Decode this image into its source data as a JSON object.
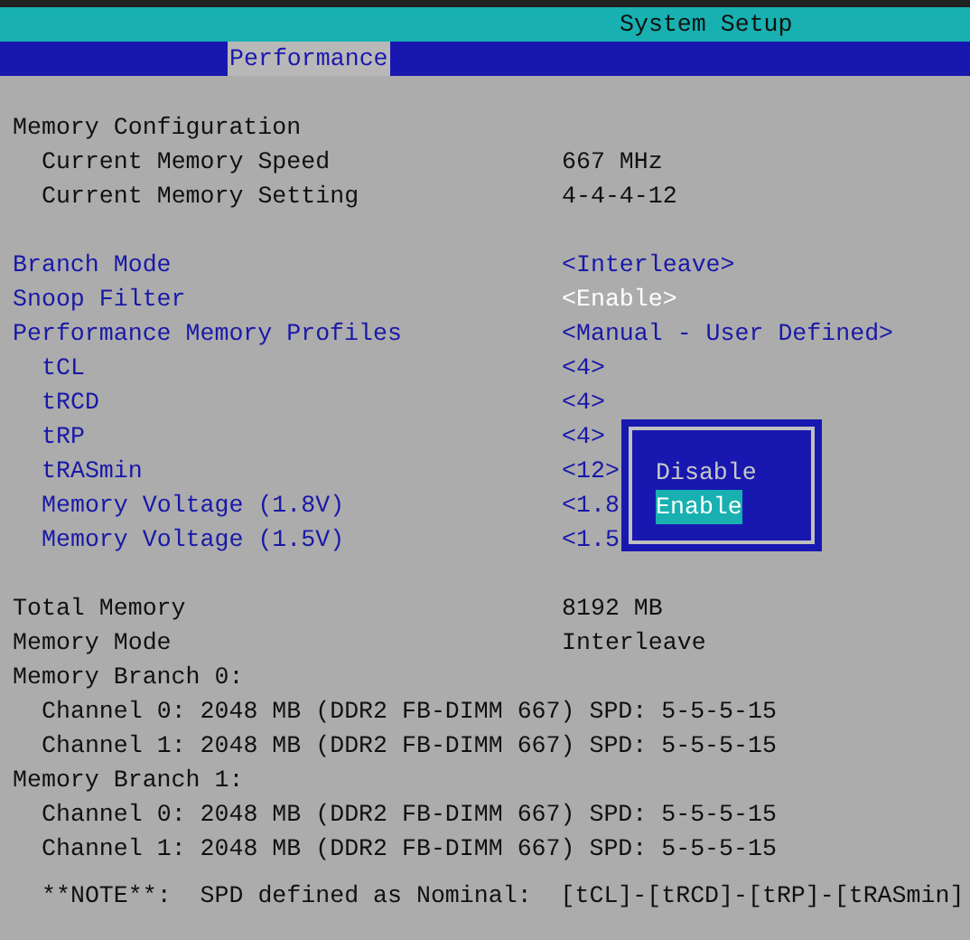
{
  "window": {
    "title": "System Setup"
  },
  "tabs": [
    {
      "label": "Performance",
      "selected": true
    }
  ],
  "sections": [
    {
      "items": [
        {
          "kind": "info",
          "label": "Memory Configuration",
          "children": [
            {
              "kind": "info",
              "label": "Current Memory Speed",
              "value": "667 MHz"
            },
            {
              "kind": "info",
              "label": "Current Memory Setting",
              "value": "4-4-4-12"
            }
          ]
        }
      ]
    },
    {
      "items": [
        {
          "kind": "option",
          "label": "Branch Mode",
          "value": "<Interleave>",
          "selected": false
        },
        {
          "kind": "option",
          "label": "Snoop Filter",
          "value": "<Enable>",
          "selected": true
        },
        {
          "kind": "option",
          "label": "Performance Memory Profiles",
          "value": "<Manual - User Defined>",
          "selected": false,
          "children": [
            {
              "kind": "option",
              "label": "tCL",
              "value": "<4>",
              "selected": false
            },
            {
              "kind": "option",
              "label": "tRCD",
              "value": "<4>",
              "selected": false
            },
            {
              "kind": "option",
              "label": "tRP",
              "value": "<4>",
              "selected": false
            },
            {
              "kind": "option",
              "label": "tRASmin",
              "value": "<12>",
              "selected": false
            },
            {
              "kind": "option",
              "label": "Memory Voltage (1.8V)",
              "value": "<1.8",
              "selected": false
            },
            {
              "kind": "option",
              "label": "Memory Voltage (1.5V)",
              "value": "<1.5",
              "selected": false
            }
          ]
        }
      ]
    },
    {
      "items": [
        {
          "kind": "info",
          "label": "Total Memory",
          "value": "8192 MB"
        },
        {
          "kind": "info",
          "label": "Memory Mode",
          "value": "Interleave"
        },
        {
          "kind": "info",
          "label": "Memory Branch 0:",
          "children": [
            {
              "kind": "info",
              "label": "Channel 0: 2048 MB (DDR2 FB-DIMM 667) SPD: 5-5-5-15"
            },
            {
              "kind": "info",
              "label": "Channel 1: 2048 MB (DDR2 FB-DIMM 667) SPD: 5-5-5-15"
            }
          ]
        },
        {
          "kind": "info",
          "label": "Memory Branch 1:",
          "children": [
            {
              "kind": "info",
              "label": "Channel 0: 2048 MB (DDR2 FB-DIMM 667) SPD: 5-5-5-15"
            },
            {
              "kind": "info",
              "label": "Channel 1: 2048 MB (DDR2 FB-DIMM 667) SPD: 5-5-5-15"
            }
          ]
        }
      ]
    }
  ],
  "popup": {
    "options": [
      {
        "label": "Disable",
        "selected": false
      },
      {
        "label": "Enable",
        "selected": true
      }
    ]
  },
  "note": "**NOTE**:  SPD defined as Nominal:  [tCL]-[tRCD]-[tRP]-[tRASmin]"
}
